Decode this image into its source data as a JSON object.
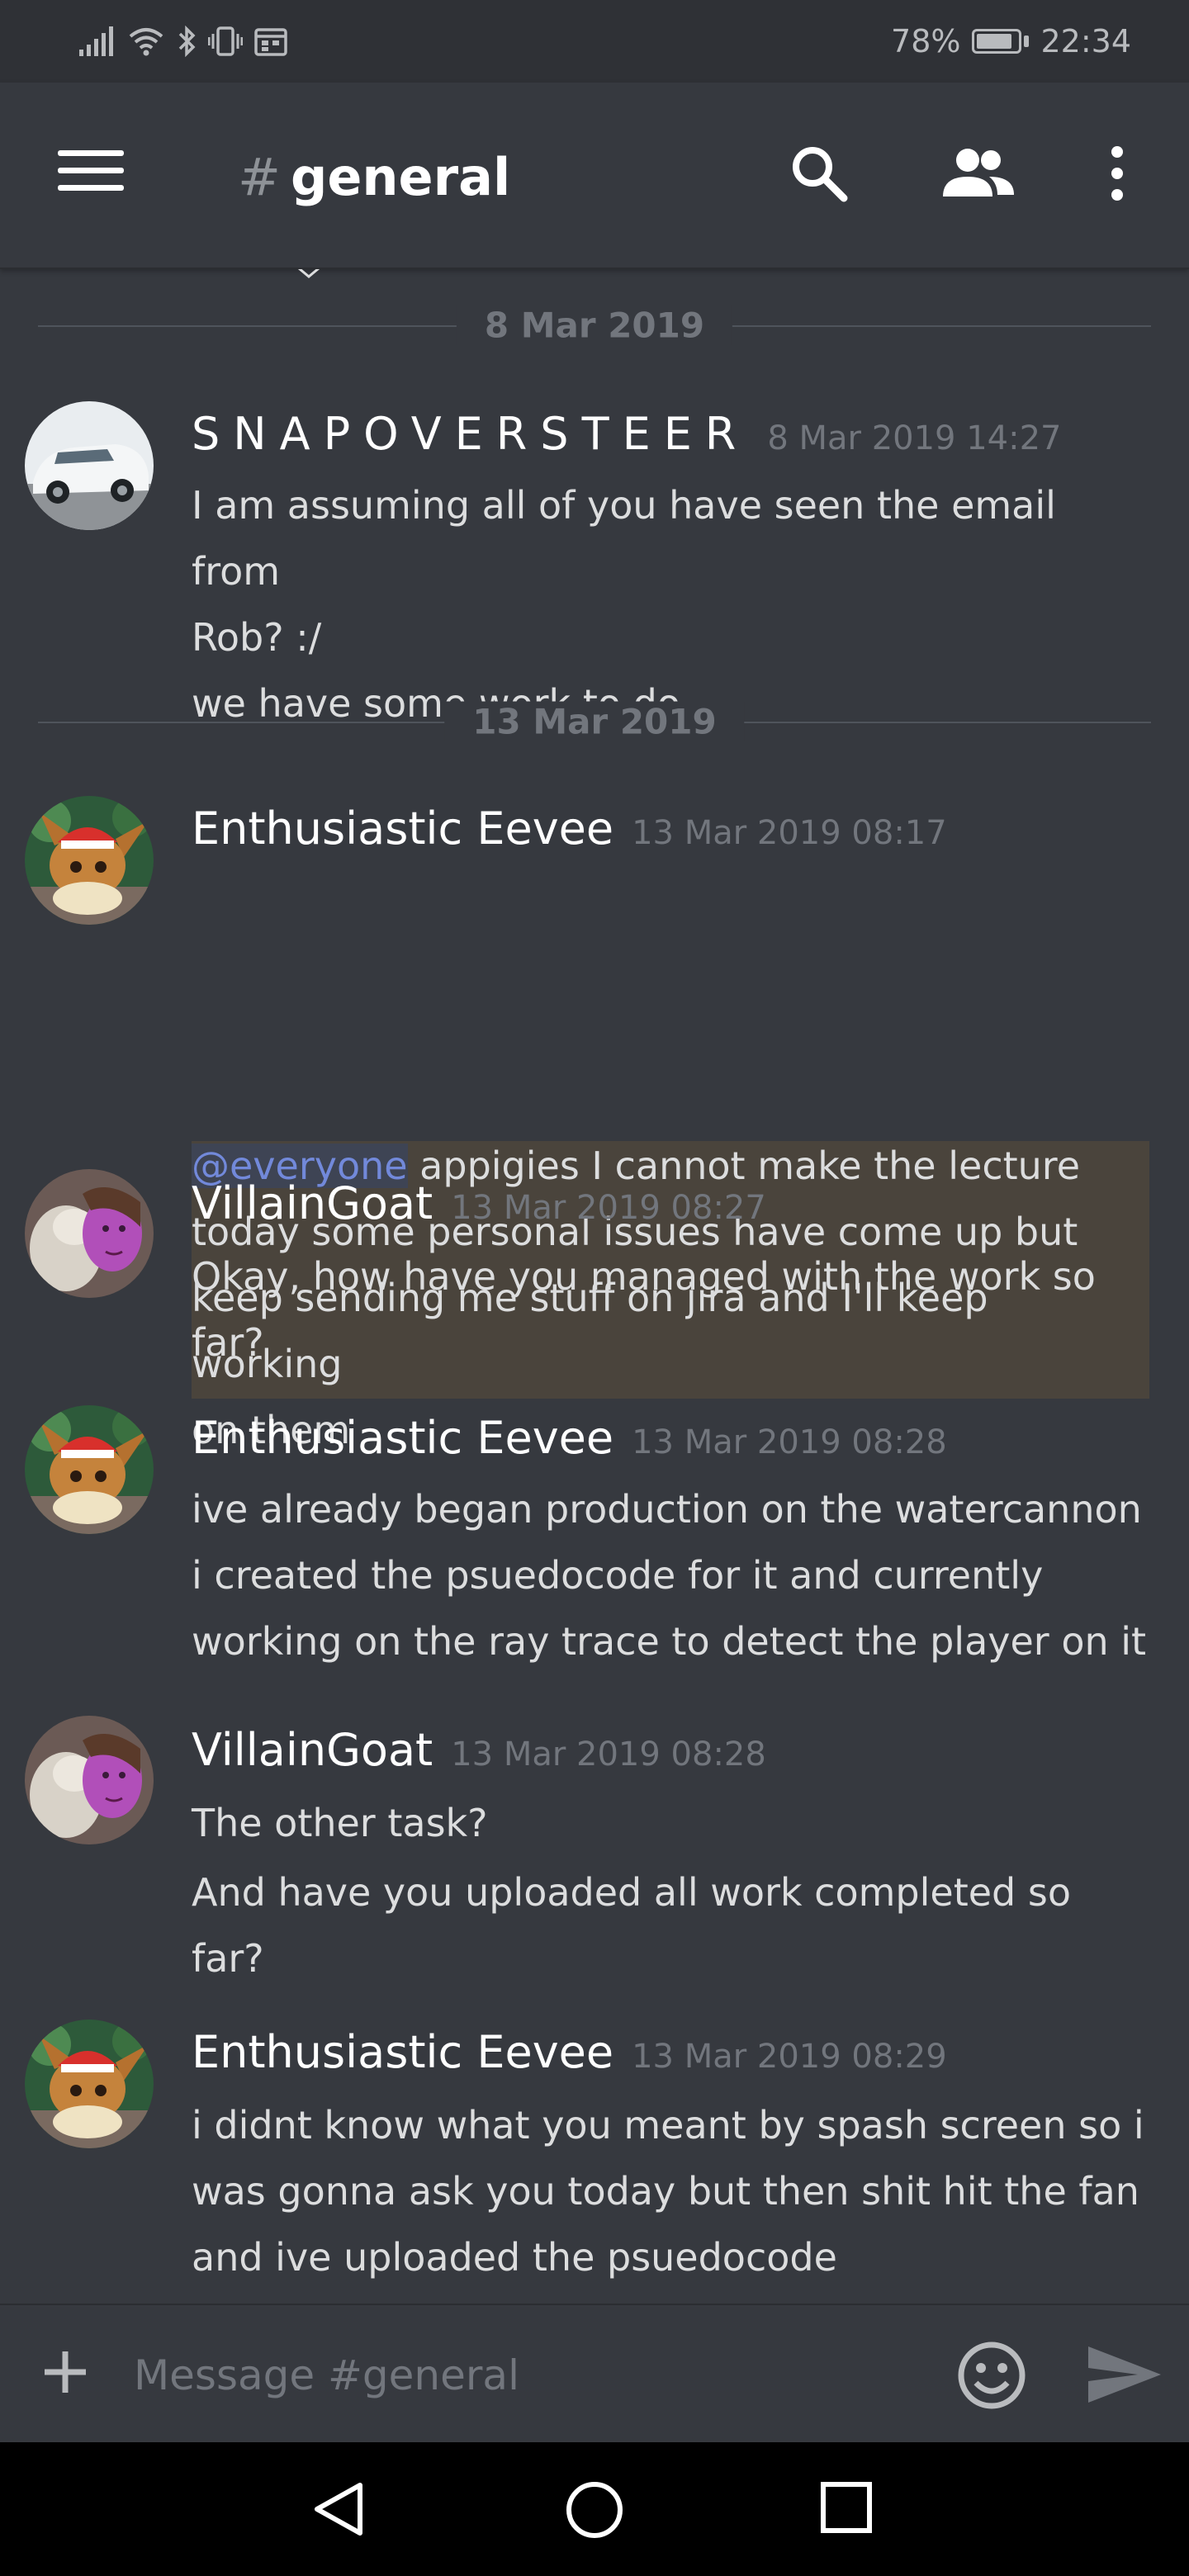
{
  "status_bar": {
    "battery_percent": "78%",
    "time": "22:34"
  },
  "header": {
    "hash": "#",
    "channel_name": "general"
  },
  "dividers": [
    {
      "label": "8 Mar 2019"
    },
    {
      "label": "13 Mar 2019"
    }
  ],
  "messages": [
    {
      "author": "SNAPOVERSTEER",
      "timestamp": "8 Mar 2019 14:27",
      "lines": [
        "I am assuming all of you have seen the email from",
        "Rob? :/",
        "we have some work to do"
      ]
    },
    {
      "author": "Enthusiastic Eevee",
      "timestamp": "13 Mar 2019 08:17",
      "mention": "@everyone",
      "lines_after_mention": [
        " appigies I cannot make the lecture",
        "today some personal issues have come up but",
        "keep sending me stuff on jira and I'll keep working",
        "on them"
      ]
    },
    {
      "author": "VillainGoat",
      "timestamp": "13 Mar 2019 08:27",
      "lines": [
        "Okay, how have you managed with the work so",
        "far?"
      ]
    },
    {
      "author": "Enthusiastic Eevee",
      "timestamp": "13 Mar 2019 08:28",
      "lines": [
        "ive already began production on the watercannon",
        "i created the psuedocode for it and currently",
        "working on the ray trace to detect the player on it"
      ]
    },
    {
      "author": "VillainGoat",
      "timestamp": "13 Mar 2019 08:28",
      "lines": [
        "The other task?",
        "And have you uploaded all work completed so",
        "far?"
      ]
    },
    {
      "author": "Enthusiastic Eevee",
      "timestamp": "13 Mar 2019 08:29",
      "lines": [
        "i didnt know what you meant by spash screen so i",
        "was gonna ask you today but then shit hit the fan",
        "and ive uploaded the psuedocode"
      ]
    }
  ],
  "composer": {
    "placeholder": "Message #general"
  },
  "icons": {
    "menu": "hamburger-icon",
    "search": "search-icon",
    "members": "members-icon",
    "more": "more-vertical-icon",
    "add": "plus-icon",
    "emoji": "emoji-icon",
    "send": "send-icon",
    "back": "back-triangle-icon",
    "home": "home-circle-icon",
    "recents": "recents-square-icon"
  },
  "colors": {
    "background": "#36393f",
    "status_bar": "#2f3136",
    "mention_text": "#7289da",
    "mention_highlight": "#4a443c",
    "timestamp": "#72767d"
  }
}
